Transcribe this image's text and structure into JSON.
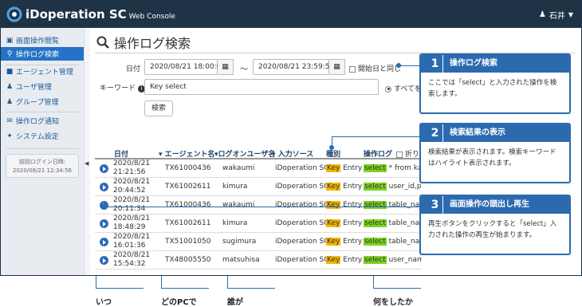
{
  "app": {
    "brand": "iDoperation SC",
    "brand_sub": "Web Console",
    "user": "石井"
  },
  "sidebar": {
    "items": [
      {
        "label": "画面操作閲覧",
        "icon": "monitor-icon"
      },
      {
        "label": "操作ログ検索",
        "icon": "search-icon",
        "active": true
      },
      {
        "label": "エージェント管理",
        "icon": "camera-icon"
      },
      {
        "label": "ユーザ管理",
        "icon": "user-icon"
      },
      {
        "label": "グループ管理",
        "icon": "group-icon"
      },
      {
        "label": "操作ログ通知",
        "icon": "notify-icon"
      },
      {
        "label": "システム設定",
        "icon": "wrench-icon"
      }
    ],
    "last_login_label": "前回ログイン日時:",
    "last_login_value": "2020/08/21 12:34:56"
  },
  "page": {
    "title": "操作ログ検索"
  },
  "form": {
    "date_label": "日付",
    "date_from": "2020/08/21 18:00:00",
    "date_sep": "〜",
    "date_to": "2020/08/21 23:59:59",
    "same_as_start": "開始日と同じ",
    "keyword_label": "キーワード",
    "keyword_value": "Key select",
    "radio_all": "すべてを",
    "search_button": "検索"
  },
  "table": {
    "headers": [
      "日付",
      "エージェント名",
      "ログオンユーザ名",
      "入力ソース",
      "種別",
      "操作ログ"
    ],
    "wrap_label": "折り",
    "rows": [
      {
        "date": "2020/8/21",
        "time": "21:21:56",
        "agent": "TX61000436",
        "user": "wakaumi",
        "source": "iDoperation SC",
        "kind": "Entry",
        "log": " * from kaike"
      },
      {
        "date": "2020/8/21",
        "time": "20:44:52",
        "agent": "TX61002611",
        "user": "kimura",
        "source": "iDoperation SC",
        "kind": "Entry",
        "log": " user_id,password from kaikei.users,[Return]"
      },
      {
        "date": "2020/8/21",
        "time": "20:11:34",
        "agent": "TX61000436",
        "user": "wakaumi",
        "source": "iDoperation SC",
        "kind": "Entry",
        "log": " table_name,"
      },
      {
        "date": "2020/8/21",
        "time": "18:48:29",
        "agent": "TX61002611",
        "user": "kimura",
        "source": "iDoperation SC",
        "kind": "Entry",
        "log": " table_name,"
      },
      {
        "date": "2020/8/21",
        "time": "16:01:36",
        "agent": "TX51001050",
        "user": "sugimura",
        "source": "iDoperation SC",
        "kind": "Entry",
        "log": " table_name,"
      },
      {
        "date": "2020/8/21",
        "time": "15:54:32",
        "agent": "TX48005550",
        "user": "matsuhisa",
        "source": "iDoperation SC",
        "kind": "Entry",
        "log": " user_name from emp where date >= to_date('2020/08/01,'YY..."
      }
    ],
    "key_tag": "Key",
    "select_tag": "select"
  },
  "callouts": [
    {
      "num": "1",
      "title": "操作ログ検索",
      "body": "ここでは「select」と入力された操作を検索します。"
    },
    {
      "num": "2",
      "title": "検索結果の表示",
      "body": "検索結果が表示されます。検索キーワードはハイライト表示されます。"
    },
    {
      "num": "3",
      "title": "画面操作の頭出し再生",
      "body": "再生ボタンをクリックすると「select」入力された操作の再生が始まります。"
    }
  ],
  "bottom_labels": [
    "いつ",
    "どのPCで",
    "誰が",
    "何をしたか"
  ],
  "colors": {
    "topbar": "#1f3346",
    "accent": "#2c6ab0",
    "key_highlight": "#f5b800",
    "select_highlight": "#7dd321"
  }
}
